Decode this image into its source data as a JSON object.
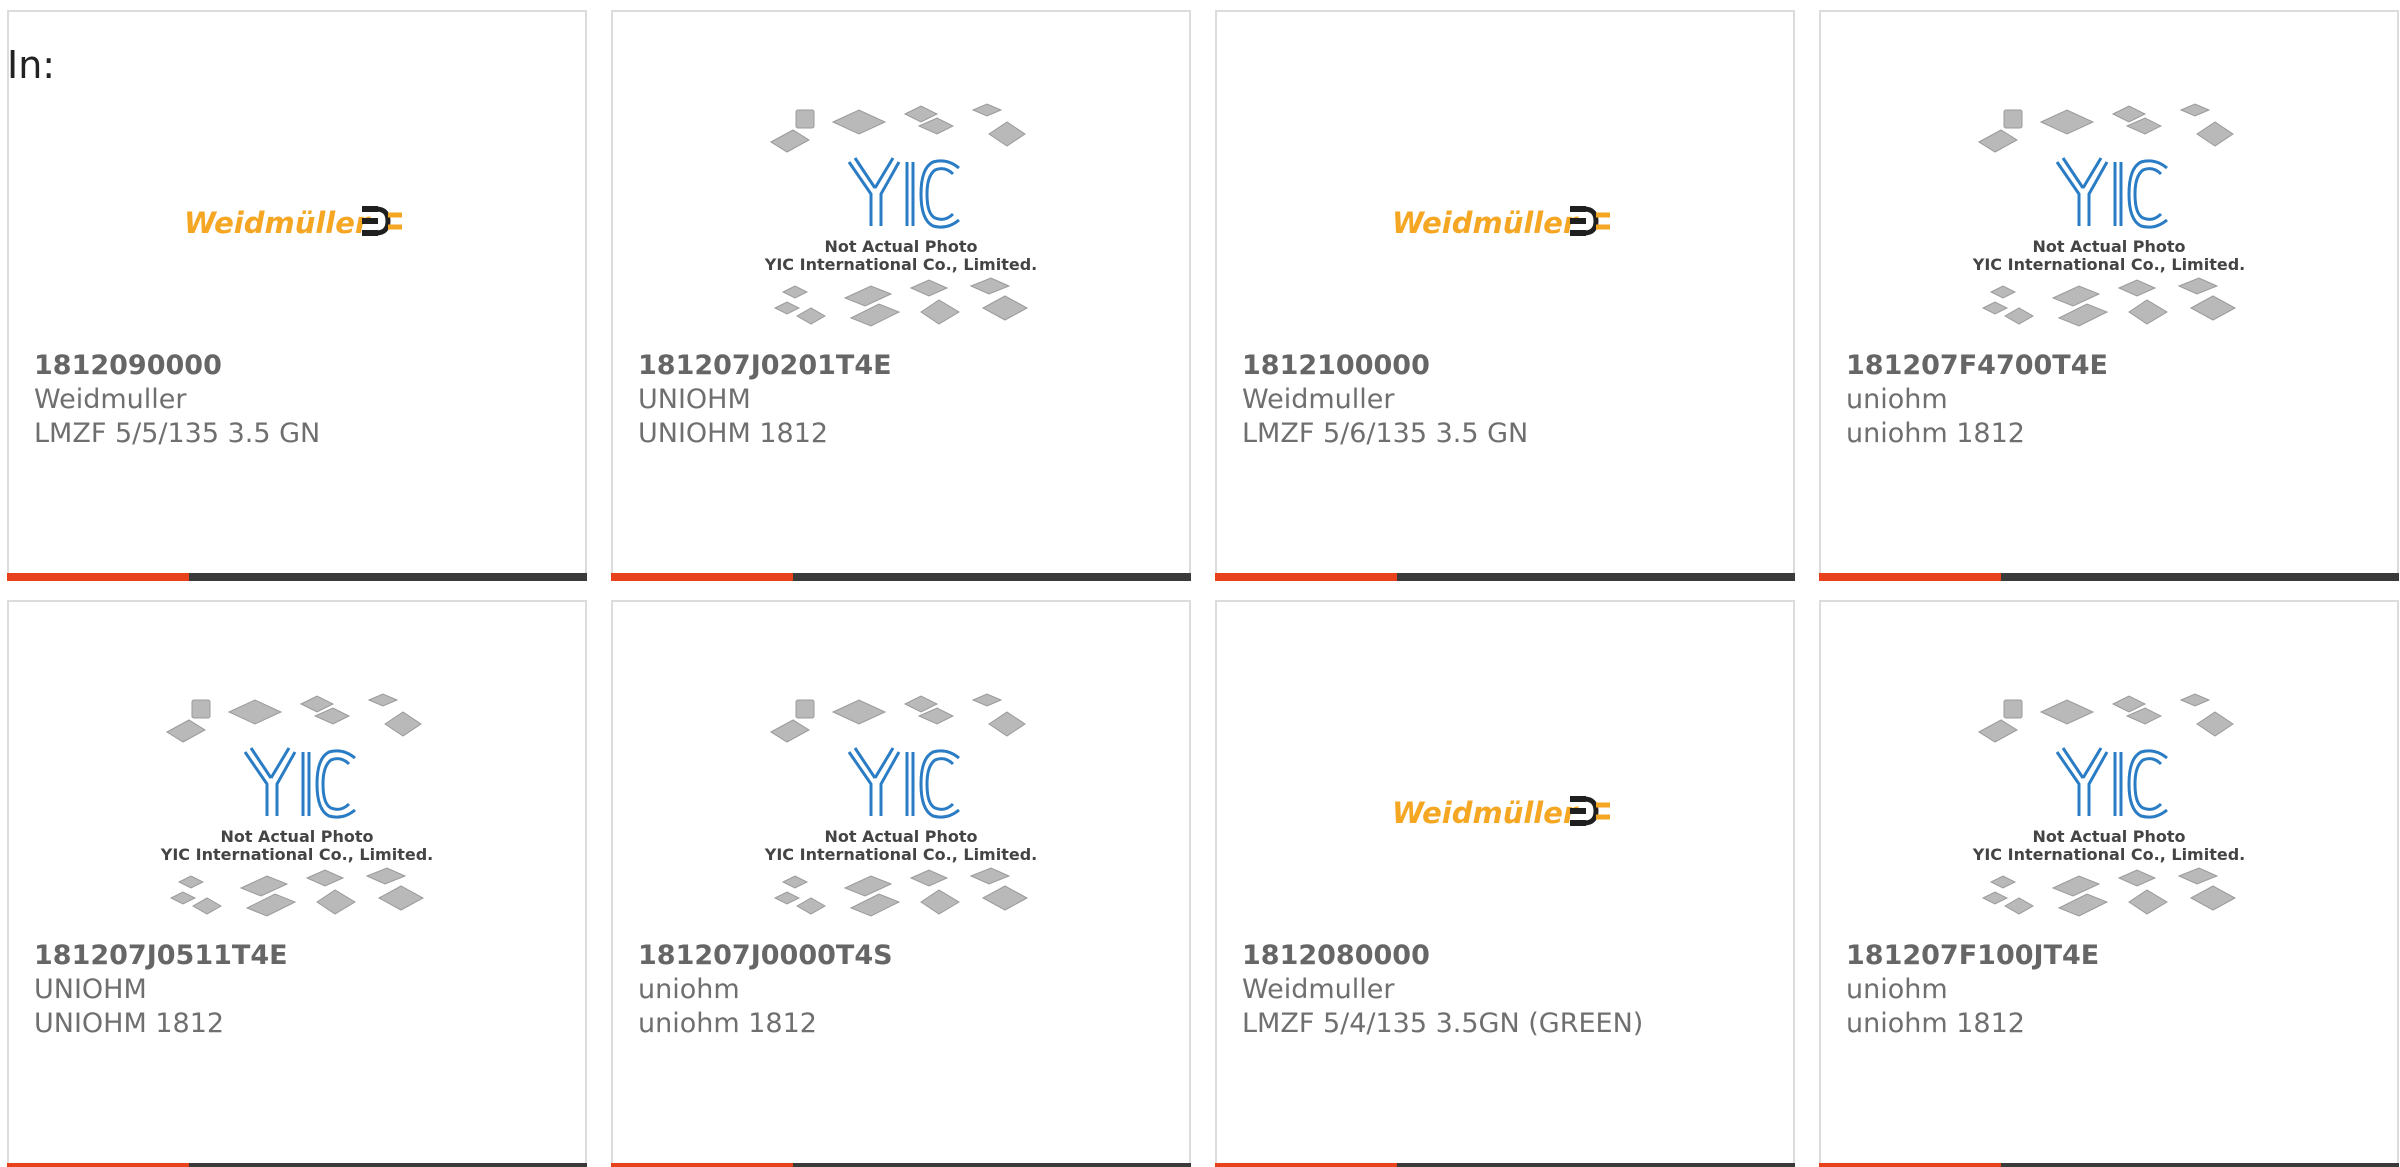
{
  "label": "In:",
  "colors": {
    "accent_bar": "#e8421c",
    "dark_bar": "#3a3a3a",
    "weidmuller_orange": "#f5a623",
    "yic_blue": "#2a7cc4"
  },
  "placeholder": {
    "line1": "Not Actual Photo",
    "line2": "YIC International Co., Limited.",
    "logo_text": "YIC"
  },
  "weidmuller_logo_text": "Weidmüller",
  "cards": [
    {
      "part_number": "1812090000",
      "manufacturer": "Weidmuller",
      "description": "LMZF 5/5/135 3.5 GN",
      "image": "weidmuller-logo"
    },
    {
      "part_number": "181207J0201T4E",
      "manufacturer": "UNIOHM",
      "description": "UNIOHM 1812",
      "image": "yic-placeholder"
    },
    {
      "part_number": "1812100000",
      "manufacturer": "Weidmuller",
      "description": "LMZF 5/6/135 3.5 GN",
      "image": "weidmuller-logo"
    },
    {
      "part_number": "181207F4700T4E",
      "manufacturer": "uniohm",
      "description": "uniohm 1812",
      "image": "yic-placeholder"
    },
    {
      "part_number": "181207J0511T4E",
      "manufacturer": "UNIOHM",
      "description": "UNIOHM 1812",
      "image": "yic-placeholder"
    },
    {
      "part_number": "181207J0000T4S",
      "manufacturer": "uniohm",
      "description": "uniohm 1812",
      "image": "yic-placeholder"
    },
    {
      "part_number": "1812080000",
      "manufacturer": "Weidmuller",
      "description": "LMZF 5/4/135 3.5GN (GREEN)",
      "image": "weidmuller-logo"
    },
    {
      "part_number": "181207F100JT4E",
      "manufacturer": "uniohm",
      "description": "uniohm 1812",
      "image": "yic-placeholder"
    }
  ]
}
